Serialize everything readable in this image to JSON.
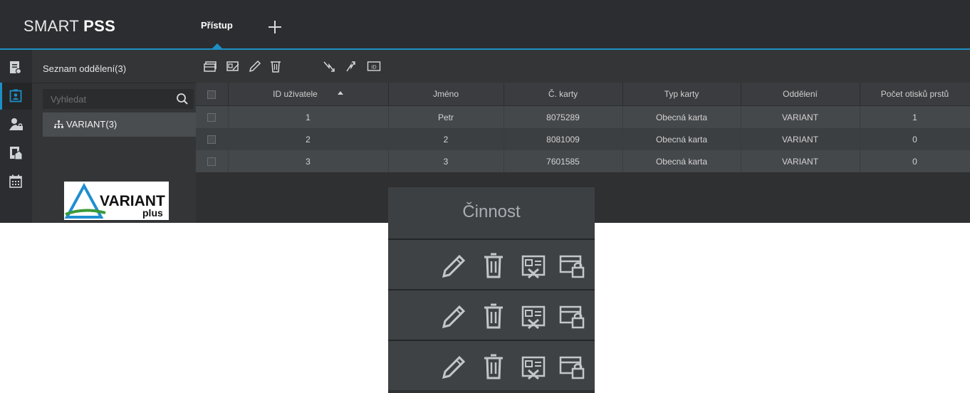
{
  "app": {
    "brand_light": "SMART ",
    "brand_bold": "PSS"
  },
  "tabs": [
    {
      "label": "Přístup",
      "active": true
    }
  ],
  "colors": {
    "accent": "#1e8fc6",
    "background": "#333537",
    "row_odd": "#45484b",
    "row_even": "#3c3f42"
  },
  "sidebar_rail": [
    {
      "icon": "report-icon"
    },
    {
      "icon": "user-card-icon",
      "active": true
    },
    {
      "icon": "user-lock-icon"
    },
    {
      "icon": "door-icon"
    },
    {
      "icon": "calendar-icon"
    }
  ],
  "department": {
    "title": "Seznam oddělení(3)",
    "search_placeholder": "Vyhledat",
    "tree_item": "VARIANT(3)",
    "logo": {
      "brand": "VARIANT",
      "sub": "plus"
    }
  },
  "toolbar": [
    {
      "icon": "batch-add-icon"
    },
    {
      "icon": "card-issue-icon"
    },
    {
      "icon": "edit-icon"
    },
    {
      "icon": "delete-icon"
    },
    {
      "icon": "import-icon"
    },
    {
      "icon": "export-icon"
    },
    {
      "icon": "id-card-icon",
      "text": "ID"
    }
  ],
  "table": {
    "columns": [
      "ID uživatele",
      "Jméno",
      "Č. karty",
      "Typ karty",
      "Oddělení",
      "Počet otisků prstů"
    ],
    "sorted_column": "ID uživatele",
    "rows": [
      [
        "1",
        "Petr",
        "8075289",
        "Obecná karta",
        "VARIANT",
        "1"
      ],
      [
        "2",
        "2",
        "8081009",
        "Obecná karta",
        "VARIANT",
        "0"
      ],
      [
        "3",
        "3",
        "7601585",
        "Obecná karta",
        "VARIANT",
        "0"
      ]
    ]
  },
  "action_panel": {
    "header": "Činnost",
    "row_actions": [
      "edit-icon",
      "delete-icon",
      "cancel-card-icon",
      "lock-card-icon"
    ]
  }
}
